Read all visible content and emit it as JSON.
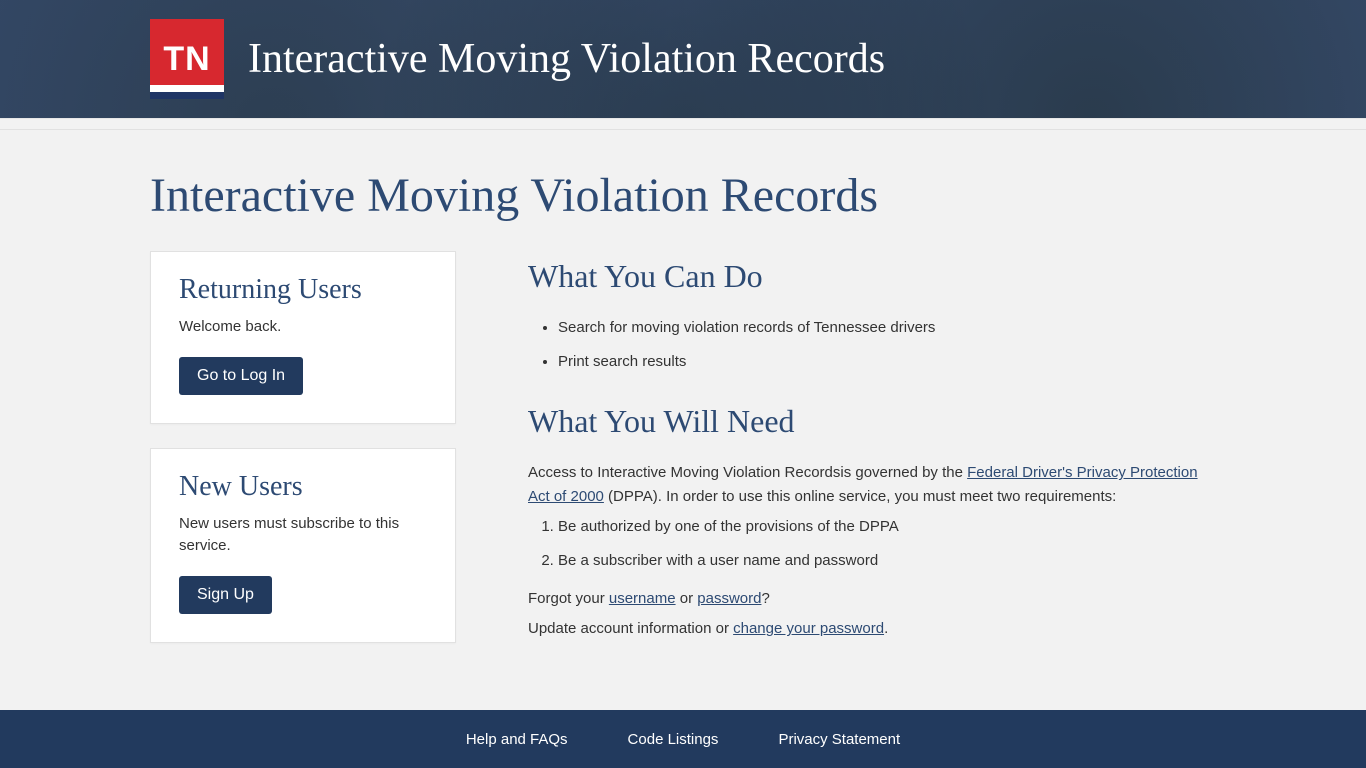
{
  "header": {
    "logo_text": "TN",
    "title": "Interactive Moving Violation Records"
  },
  "page": {
    "title": "Interactive Moving Violation Records"
  },
  "sidebar": {
    "returning": {
      "heading": "Returning Users",
      "text": "Welcome back.",
      "button": "Go to Log In"
    },
    "new": {
      "heading": "New Users",
      "text": "New users must subscribe to this service.",
      "button": "Sign Up"
    }
  },
  "content": {
    "cando_heading": "What You Can Do",
    "cando_items": [
      "Search for moving violation records of Tennessee drivers",
      "Print search results"
    ],
    "need_heading": "What You Will Need",
    "need_intro_1": "Access to Interactive Moving Violation Recordsis governed by the ",
    "need_intro_link": "Federal Driver's Privacy Protection Act of 2000",
    "need_intro_2": " (DPPA). In order to use this online service, you must meet two requirements:",
    "requirements": [
      "Be authorized by one of the provisions of the DPPA",
      "Be a subscriber with a user name and password"
    ],
    "forgot_prefix": "Forgot your ",
    "forgot_username": "username",
    "forgot_or": " or ",
    "forgot_password": "password",
    "forgot_q": "?",
    "update_prefix": "Update account information or ",
    "update_link": "change your password",
    "update_period": "."
  },
  "footer": {
    "help": "Help and FAQs",
    "codes": "Code Listings",
    "privacy": "Privacy Statement"
  }
}
